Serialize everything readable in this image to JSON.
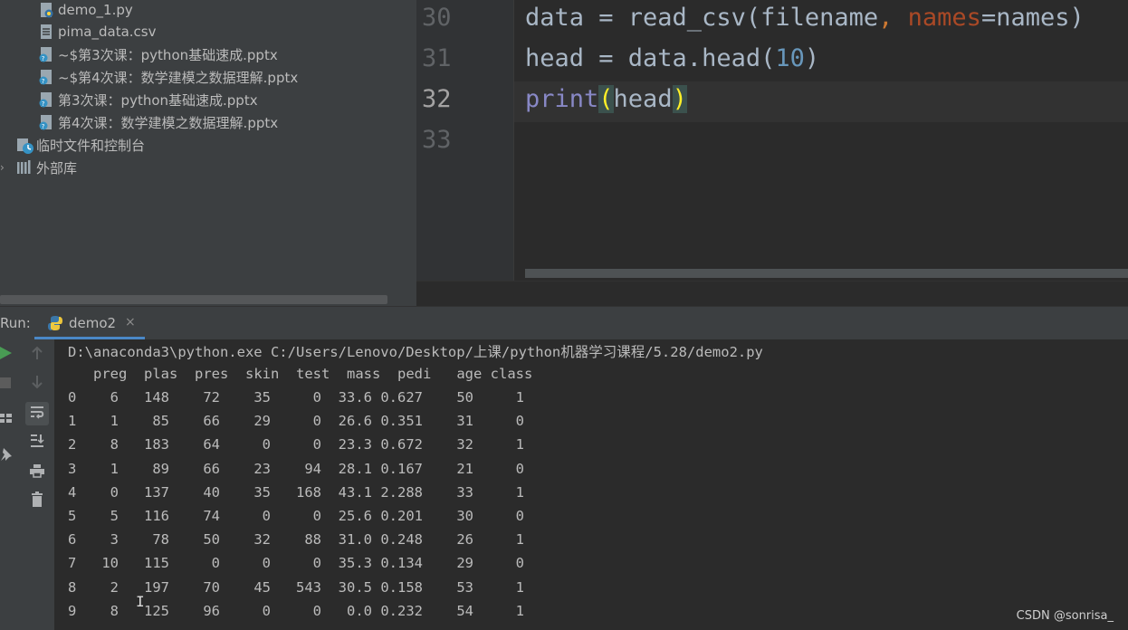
{
  "project_tree": {
    "items": [
      {
        "label": "demo_1.py",
        "icon": "python-file-icon"
      },
      {
        "label": "pima_data.csv",
        "icon": "text-file-icon"
      },
      {
        "label": "~$第3次课：python基础速成.pptx",
        "icon": "unknown-file-icon"
      },
      {
        "label": "~$第4次课：数学建模之数据理解.pptx",
        "icon": "unknown-file-icon"
      },
      {
        "label": "第3次课：python基础速成.pptx",
        "icon": "unknown-file-icon"
      },
      {
        "label": "第4次课：数学建模之数据理解.pptx",
        "icon": "unknown-file-icon"
      },
      {
        "label": "临时文件和控制台",
        "icon": "scratches-icon"
      },
      {
        "label": "外部库",
        "icon": "external-libraries-icon"
      }
    ]
  },
  "editor": {
    "line_numbers": [
      "30",
      "31",
      "32",
      "33"
    ],
    "current_line": "32",
    "lines": [
      [
        "data = read_csv(filename",
        ", ",
        "names",
        "=names)"
      ],
      [
        "head = data.head(",
        "10",
        ")"
      ],
      [
        "print",
        "(",
        "head",
        ")"
      ],
      []
    ]
  },
  "run": {
    "label": "Run:",
    "tab_label": "demo2",
    "close_glyph": "×"
  },
  "console": {
    "command": "D:\\anaconda3\\python.exe C:/Users/Lenovo/Desktop/上课/python机器学习课程/5.28/demo2.py",
    "columns": [
      "preg",
      "plas",
      "pres",
      "skin",
      "test",
      "mass",
      "pedi",
      "age",
      "class"
    ],
    "rows": [
      [
        "0",
        "6",
        "148",
        "72",
        "35",
        "0",
        "33.6",
        "0.627",
        "50",
        "1"
      ],
      [
        "1",
        "1",
        "85",
        "66",
        "29",
        "0",
        "26.6",
        "0.351",
        "31",
        "0"
      ],
      [
        "2",
        "8",
        "183",
        "64",
        "0",
        "0",
        "23.3",
        "0.672",
        "32",
        "1"
      ],
      [
        "3",
        "1",
        "89",
        "66",
        "23",
        "94",
        "28.1",
        "0.167",
        "21",
        "0"
      ],
      [
        "4",
        "0",
        "137",
        "40",
        "35",
        "168",
        "43.1",
        "2.288",
        "33",
        "1"
      ],
      [
        "5",
        "5",
        "116",
        "74",
        "0",
        "0",
        "25.6",
        "0.201",
        "30",
        "0"
      ],
      [
        "6",
        "3",
        "78",
        "50",
        "32",
        "88",
        "31.0",
        "0.248",
        "26",
        "1"
      ],
      [
        "7",
        "10",
        "115",
        "0",
        "0",
        "0",
        "35.3",
        "0.134",
        "29",
        "0"
      ],
      [
        "8",
        "2",
        "197",
        "70",
        "45",
        "543",
        "30.5",
        "0.158",
        "53",
        "1"
      ],
      [
        "9",
        "8",
        "125",
        "96",
        "0",
        "0",
        "0.0",
        "0.232",
        "54",
        "1"
      ]
    ]
  },
  "watermark": "CSDN @sonrisa_",
  "colors": {
    "accent": "#4a88c7",
    "run_green": "#499c54",
    "bracket_highlight": "#ffef28"
  }
}
